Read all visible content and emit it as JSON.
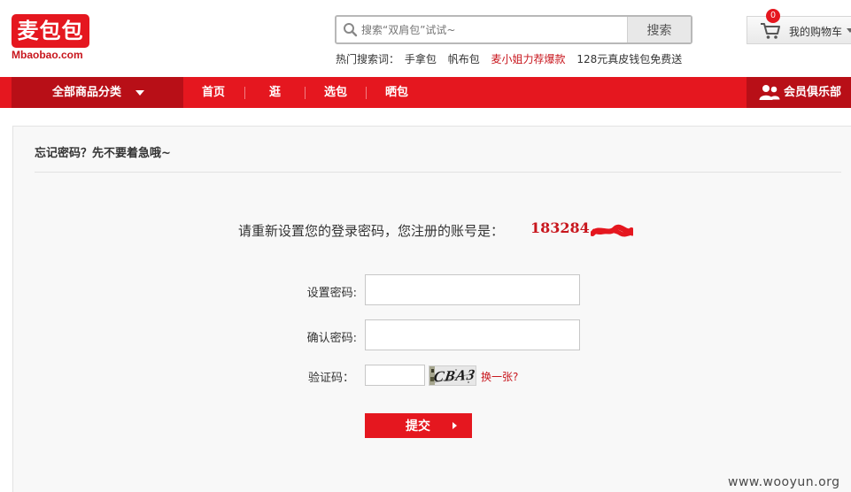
{
  "header": {
    "logo_cn": "麦包包",
    "logo_en": "Mbaobao.com",
    "search": {
      "placeholder": "搜索“双肩包”试试~",
      "button_label": "搜索"
    },
    "hot_search": {
      "label": "热门搜索词：",
      "terms": [
        "手拿包",
        "帆布包",
        "麦小姐力荐爆款",
        "128元真皮钱包免费送"
      ]
    },
    "cart": {
      "count": "0",
      "label": "我的购物车"
    }
  },
  "nav": {
    "category_label": "全部商品分类",
    "items": [
      "首页",
      "逛",
      "选包",
      "晒包"
    ],
    "club_label": "会员俱乐部"
  },
  "panel": {
    "title": "忘记密码？先不要着急哦~",
    "intro": "请重新设置您的登录密码，您注册的账号是：",
    "account": "183284",
    "form": {
      "password_label": "设置密码:",
      "confirm_label": "确认密码:",
      "captcha_label": "验证码：",
      "captcha_text": "CBA3",
      "refresh_label": "换一张?",
      "submit_label": "提交"
    }
  },
  "watermark": "www.wooyun.org",
  "colors": {
    "brand_red": "#e5171f",
    "dark_red": "#b80f17",
    "link_red": "#c8161d"
  }
}
